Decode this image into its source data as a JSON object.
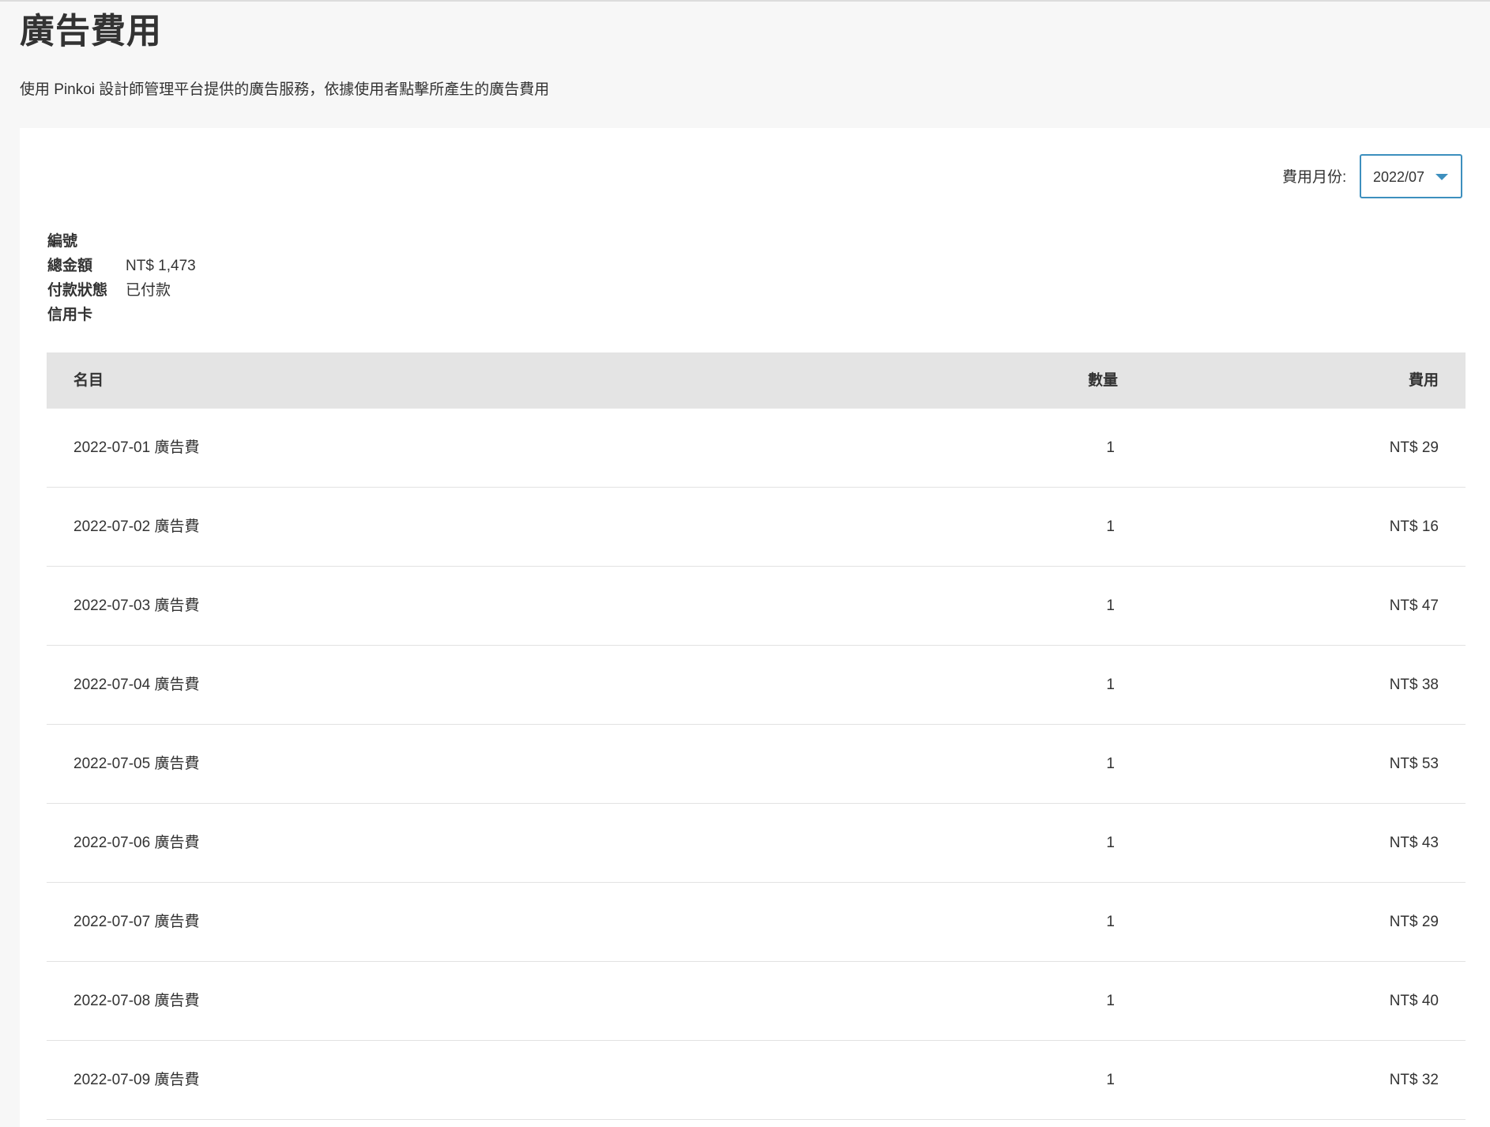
{
  "header": {
    "title": "廣告費用",
    "description": "使用 Pinkoi 設計師管理平台提供的廣告服務，依據使用者點擊所產生的廣告費用"
  },
  "month_filter": {
    "label": "費用月份:",
    "selected": "2022/07"
  },
  "summary": {
    "id_label": "編號",
    "id_value": "",
    "total_label": "總金額",
    "total_value": "NT$ 1,473",
    "status_label": "付款狀態",
    "status_value": "已付款",
    "card_label": "信用卡",
    "card_value": ""
  },
  "table": {
    "headers": {
      "name": "名目",
      "qty": "數量",
      "fee": "費用"
    },
    "rows": [
      {
        "name": "2022-07-01 廣告費",
        "qty": "1",
        "fee": "NT$ 29"
      },
      {
        "name": "2022-07-02 廣告費",
        "qty": "1",
        "fee": "NT$ 16"
      },
      {
        "name": "2022-07-03 廣告費",
        "qty": "1",
        "fee": "NT$ 47"
      },
      {
        "name": "2022-07-04 廣告費",
        "qty": "1",
        "fee": "NT$ 38"
      },
      {
        "name": "2022-07-05 廣告費",
        "qty": "1",
        "fee": "NT$ 53"
      },
      {
        "name": "2022-07-06 廣告費",
        "qty": "1",
        "fee": "NT$ 43"
      },
      {
        "name": "2022-07-07 廣告費",
        "qty": "1",
        "fee": "NT$ 29"
      },
      {
        "name": "2022-07-08 廣告費",
        "qty": "1",
        "fee": "NT$ 40"
      },
      {
        "name": "2022-07-09 廣告費",
        "qty": "1",
        "fee": "NT$ 32"
      }
    ]
  },
  "colors": {
    "accent": "#3d8fbe",
    "page_bg": "#f7f7f7",
    "table_header_bg": "#e4e4e4"
  },
  "icons": {
    "dropdown": "chevron-down-icon"
  }
}
